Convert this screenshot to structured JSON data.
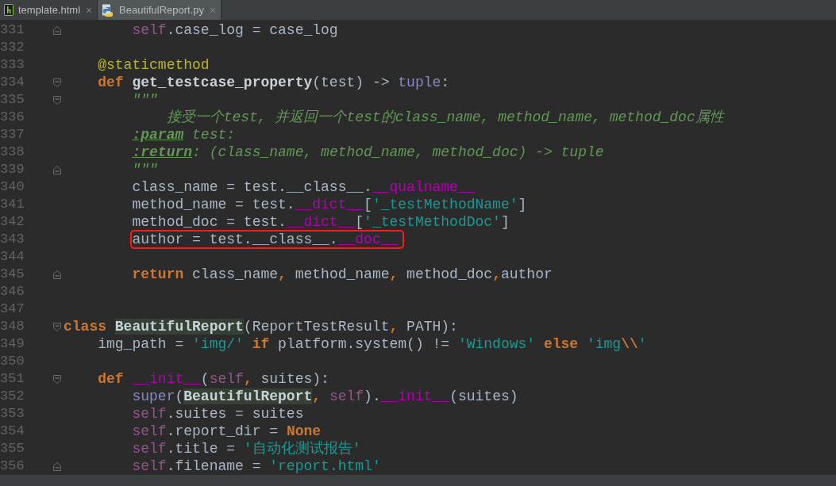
{
  "tabs": [
    {
      "label": "template.html",
      "kind": "html",
      "selected": false
    },
    {
      "label": "BeautifulReport.py",
      "kind": "python",
      "selected": true
    }
  ],
  "lines": [
    {
      "number": "331",
      "kind": "closer",
      "tokens": [
        {
          "kind": "self",
          "text": "        self"
        },
        {
          "kind": "plain",
          "text": ".case_log = case_log"
        }
      ]
    },
    {
      "number": "332",
      "kind": "line"
    },
    {
      "number": "333",
      "kind": "line",
      "tokens": [
        {
          "kind": "deco",
          "text": "    @staticmethod"
        }
      ]
    },
    {
      "number": "334",
      "kind": "opener",
      "tokens": [
        {
          "kind": "kw",
          "text": "    def"
        },
        {
          "kind": "fn",
          "text": " get_testcase_property"
        },
        {
          "kind": "plain",
          "text": "(test) -> "
        },
        {
          "kind": "builtin",
          "text": "tuple"
        },
        {
          "kind": "plain",
          "text": ":"
        }
      ]
    },
    {
      "number": "335",
      "kind": "opener",
      "tokens": [
        {
          "kind": "doc",
          "text": "        \"\"\""
        }
      ]
    },
    {
      "number": "336",
      "kind": "line",
      "tokens": [
        {
          "kind": "doc",
          "text": "            接受一个test, 并返回一个test的class_name, method_name, method_doc属性"
        }
      ]
    },
    {
      "number": "337",
      "kind": "line",
      "tokens": [
        {
          "kind": "docparam",
          "text": "        :param"
        },
        {
          "kind": "doc",
          "text": " test:"
        }
      ]
    },
    {
      "number": "338",
      "kind": "line",
      "tokens": [
        {
          "kind": "docparam",
          "text": "        :return"
        },
        {
          "kind": "doc",
          "text": ": (class_name, method_name, method_doc) -> tuple"
        }
      ]
    },
    {
      "number": "339",
      "kind": "closer",
      "tokens": [
        {
          "kind": "doc",
          "text": "        \"\"\""
        }
      ]
    },
    {
      "number": "340",
      "kind": "line",
      "tokens": [
        {
          "kind": "plain",
          "text": "        class_name = test.__class__."
        },
        {
          "kind": "dunder",
          "text": "__qualname__"
        }
      ]
    },
    {
      "number": "341",
      "kind": "line",
      "tokens": [
        {
          "kind": "plain",
          "text": "        method_name = test."
        },
        {
          "kind": "dunder",
          "text": "__dict__"
        },
        {
          "kind": "plain",
          "text": "["
        },
        {
          "kind": "str",
          "text": "'_testMethodName'"
        },
        {
          "kind": "plain",
          "text": "]"
        }
      ]
    },
    {
      "number": "342",
      "kind": "line",
      "tokens": [
        {
          "kind": "plain",
          "text": "        method_doc = test."
        },
        {
          "kind": "dunder",
          "text": "__dict__"
        },
        {
          "kind": "plain",
          "text": "["
        },
        {
          "kind": "str",
          "text": "'_testMethodDoc'"
        },
        {
          "kind": "plain",
          "text": "]"
        }
      ]
    },
    {
      "number": "343",
      "kind": "line",
      "boxed": true,
      "tokens": [
        {
          "kind": "plain",
          "text": "        author = test.__class__."
        },
        {
          "kind": "dunder",
          "text": "__doc__"
        }
      ]
    },
    {
      "number": "344",
      "kind": "line"
    },
    {
      "number": "345",
      "kind": "closer",
      "tokens": [
        {
          "kind": "kw",
          "text": "        return"
        },
        {
          "kind": "plain",
          "text": " class_name"
        },
        {
          "kind": "kw",
          "text": ","
        },
        {
          "kind": "plain",
          "text": " method_name"
        },
        {
          "kind": "kw",
          "text": ","
        },
        {
          "kind": "plain",
          "text": " method_doc"
        },
        {
          "kind": "kw",
          "text": ","
        },
        {
          "kind": "plain",
          "text": "author"
        }
      ]
    },
    {
      "number": "346",
      "kind": "line"
    },
    {
      "number": "347",
      "kind": "line"
    },
    {
      "number": "348",
      "kind": "opener",
      "tokens": [
        {
          "kind": "kw",
          "text": "class "
        },
        {
          "kind": "classname",
          "text": "BeautifulReport"
        },
        {
          "kind": "plain",
          "text": "(ReportTestResult"
        },
        {
          "kind": "kw",
          "text": ","
        },
        {
          "kind": "plain",
          "text": " PATH):"
        }
      ]
    },
    {
      "number": "349",
      "kind": "line",
      "tokens": [
        {
          "kind": "plain",
          "text": "    img_path = "
        },
        {
          "kind": "str",
          "text": "'img/'"
        },
        {
          "kind": "kw",
          "text": " if"
        },
        {
          "kind": "plain",
          "text": " platform.system() != "
        },
        {
          "kind": "str",
          "text": "'Windows'"
        },
        {
          "kind": "kw",
          "text": " else"
        },
        {
          "kind": "str",
          "text": " 'img"
        },
        {
          "kind": "escape",
          "text": "\\\\"
        },
        {
          "kind": "str",
          "text": "'"
        }
      ]
    },
    {
      "number": "350",
      "kind": "line"
    },
    {
      "number": "351",
      "kind": "opener",
      "tokens": [
        {
          "kind": "kw",
          "text": "    def "
        },
        {
          "kind": "dunder",
          "text": "__init__"
        },
        {
          "kind": "plain",
          "text": "("
        },
        {
          "kind": "self",
          "text": "self"
        },
        {
          "kind": "kw",
          "text": ","
        },
        {
          "kind": "plain",
          "text": " suites):"
        }
      ]
    },
    {
      "number": "352",
      "kind": "line",
      "tokens": [
        {
          "kind": "builtin",
          "text": "        super"
        },
        {
          "kind": "plain",
          "text": "("
        },
        {
          "kind": "classname",
          "text": "BeautifulReport"
        },
        {
          "kind": "kw",
          "text": ","
        },
        {
          "kind": "self",
          "text": " self"
        },
        {
          "kind": "plain",
          "text": ")."
        },
        {
          "kind": "dunder",
          "text": "__init__"
        },
        {
          "kind": "plain",
          "text": "(suites)"
        }
      ]
    },
    {
      "number": "353",
      "kind": "line",
      "tokens": [
        {
          "kind": "self",
          "text": "        self"
        },
        {
          "kind": "plain",
          "text": ".suites = suites"
        }
      ]
    },
    {
      "number": "354",
      "kind": "line",
      "tokens": [
        {
          "kind": "self",
          "text": "        self"
        },
        {
          "kind": "plain",
          "text": ".report_dir = "
        },
        {
          "kind": "kw",
          "text": "None"
        }
      ]
    },
    {
      "number": "355",
      "kind": "line",
      "tokens": [
        {
          "kind": "self",
          "text": "        self"
        },
        {
          "kind": "plain",
          "text": ".title = "
        },
        {
          "kind": "str",
          "text": "'自动化测试报告'"
        }
      ]
    },
    {
      "number": "356",
      "kind": "closer",
      "tokens": [
        {
          "kind": "self",
          "text": "        self"
        },
        {
          "kind": "plain",
          "text": ".filename = "
        },
        {
          "kind": "str",
          "text": "'report.html'"
        }
      ]
    }
  ]
}
